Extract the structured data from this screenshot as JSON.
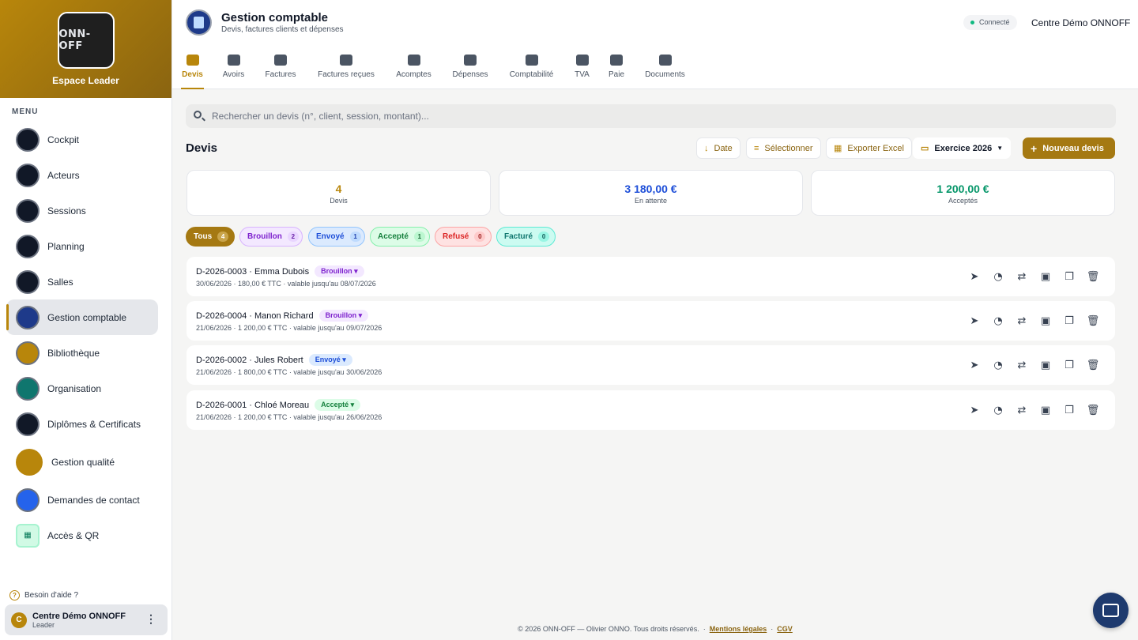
{
  "brand": {
    "logo_text": "ONN-OFF",
    "title": "Espace Leader"
  },
  "sidebar": {
    "menu_label": "MENU",
    "items": [
      {
        "label": "Cockpit",
        "icon": "dashboard-icon"
      },
      {
        "label": "Acteurs",
        "icon": "actors-icon"
      },
      {
        "label": "Sessions",
        "icon": "sessions-icon"
      },
      {
        "label": "Planning",
        "icon": "calendar-icon"
      },
      {
        "label": "Salles",
        "icon": "rooms-icon"
      },
      {
        "label": "Gestion comptable",
        "icon": "accounting-icon",
        "active": true
      },
      {
        "label": "Bibliothèque",
        "icon": "library-icon"
      },
      {
        "label": "Organisation",
        "icon": "organisation-icon"
      },
      {
        "label": "Diplômes & Certificats",
        "icon": "certificate-icon"
      },
      {
        "label": "Gestion qualité",
        "icon": "quality-icon"
      },
      {
        "label": "Demandes de contact",
        "icon": "contact-icon"
      },
      {
        "label": "Accès & QR",
        "icon": "qr-icon"
      }
    ],
    "help": "Besoin d'aide ?",
    "user": {
      "initial": "C",
      "name": "Centre Démo ONNOFF",
      "role": "Leader",
      "menu": "⋮"
    }
  },
  "header": {
    "title": "Gestion comptable",
    "subtitle": "Devis, factures clients et dépenses",
    "status": "Connecté",
    "center_name": "Centre Démo ONNOFF",
    "tabs": [
      {
        "label": "Devis",
        "active": true
      },
      {
        "label": "Avoirs"
      },
      {
        "label": "Factures"
      },
      {
        "label": "Factures reçues"
      },
      {
        "label": "Acomptes"
      },
      {
        "label": "Dépenses"
      },
      {
        "label": "Comptabilité"
      },
      {
        "label": "TVA"
      },
      {
        "label": "Paie"
      },
      {
        "label": "Documents"
      }
    ]
  },
  "search": {
    "placeholder": "Rechercher un devis (n°, client, session, montant)..."
  },
  "section": {
    "title": "Devis",
    "buttons": {
      "date": "Date",
      "select": "Sélectionner",
      "export": "Exporter Excel",
      "exercise": "Exercice 2026",
      "new": "Nouveau devis"
    }
  },
  "stats": [
    {
      "value": "4",
      "label": "Devis",
      "color": "#b8860b"
    },
    {
      "value": "3 180,00 €",
      "label": "En attente",
      "color": "#1d4ed8"
    },
    {
      "value": "1 200,00 €",
      "label": "Acceptés",
      "color": "#059669"
    }
  ],
  "filters": [
    {
      "label": "Tous",
      "count": "4"
    },
    {
      "label": "Brouillon",
      "count": "2"
    },
    {
      "label": "Envoyé",
      "count": "1"
    },
    {
      "label": "Accepté",
      "count": "1"
    },
    {
      "label": "Refusé",
      "count": "0"
    },
    {
      "label": "Facturé",
      "count": "0"
    }
  ],
  "quotes": [
    {
      "title": "D-2026-0003 · Emma Dubois",
      "status": "Brouillon ▾",
      "meta": "30/06/2026 · 180,00 € TTC · valable jusqu'au 08/07/2026"
    },
    {
      "title": "D-2026-0004 · Manon Richard",
      "status": "Brouillon ▾",
      "meta": "21/06/2026 · 1 200,00 € TTC · valable jusqu'au 09/07/2026"
    },
    {
      "title": "D-2026-0002 · Jules Robert",
      "status": "Envoyé ▾",
      "meta": "21/06/2026 · 1 800,00 € TTC · valable jusqu'au 30/06/2026"
    },
    {
      "title": "D-2026-0001 · Chloé Moreau",
      "status": "Accepté ▾",
      "meta": "21/06/2026 · 1 200,00 € TTC · valable jusqu'au 26/06/2026"
    }
  ],
  "footer": {
    "copyright": "© 2026 ONN-OFF — Olivier ONNO. Tous droits réservés.",
    "sep": "·",
    "legal": "Mentions légales",
    "cgv": "CGV"
  },
  "colors": {
    "accent": "#b8860b",
    "accent_dark": "#a57912",
    "sidebar_active": "#e5e7eb"
  }
}
